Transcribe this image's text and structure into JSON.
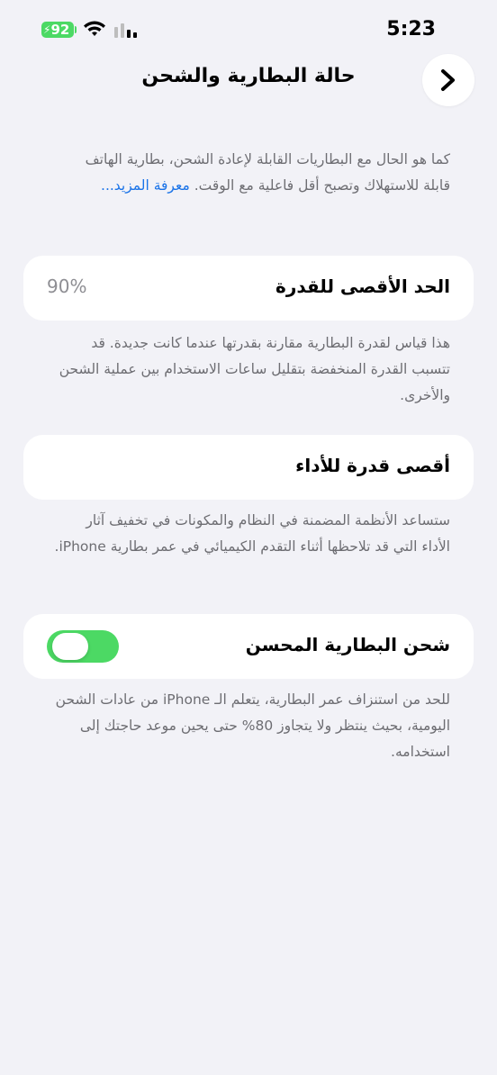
{
  "status_bar": {
    "battery_level": "92",
    "time": "5:23",
    "colors": {
      "battery": "#4cd964"
    }
  },
  "nav": {
    "title": "حالة البطارية والشحن",
    "back_icon": "chevron-right-icon"
  },
  "intro": {
    "text": "كما هو الحال مع البطاريات القابلة لإعادة الشحن، بطارية الهاتف قابلة للاستهلاك وتصبح أقل فاعلية مع الوقت.",
    "link": "معرفة المزيد..."
  },
  "max_capacity": {
    "label": "الحد الأقصى للقدرة",
    "value": "90%",
    "description": "هذا قياس لقدرة البطارية مقارنة بقدرتها عندما كانت جديدة. قد تتسبب القدرة المنخفضة بتقليل ساعات الاستخدام بين عملية الشحن والأخرى."
  },
  "peak_performance": {
    "label": "أقصى قدرة للأداء",
    "description": "ستساعد الأنظمة المضمنة في النظام والمكونات في تخفيف آثار الأداء التي قد تلاحظها أثناء التقدم الكيميائي في عمر بطارية iPhone."
  },
  "optimized_charging": {
    "label": "شحن البطارية المحسن",
    "enabled": true,
    "description": "للحد من استنزاف عمر البطارية، يتعلم الـ iPhone من عادات الشحن اليومية، بحيث ينتظر ولا يتجاوز 80% حتى يحين موعد حاجتك إلى استخدامه.",
    "colors": {
      "toggle_on": "#4cd964"
    }
  },
  "colors": {
    "background": "#f2f2f7",
    "secondary_text": "#6d6d72",
    "link": "#1a73e8"
  }
}
